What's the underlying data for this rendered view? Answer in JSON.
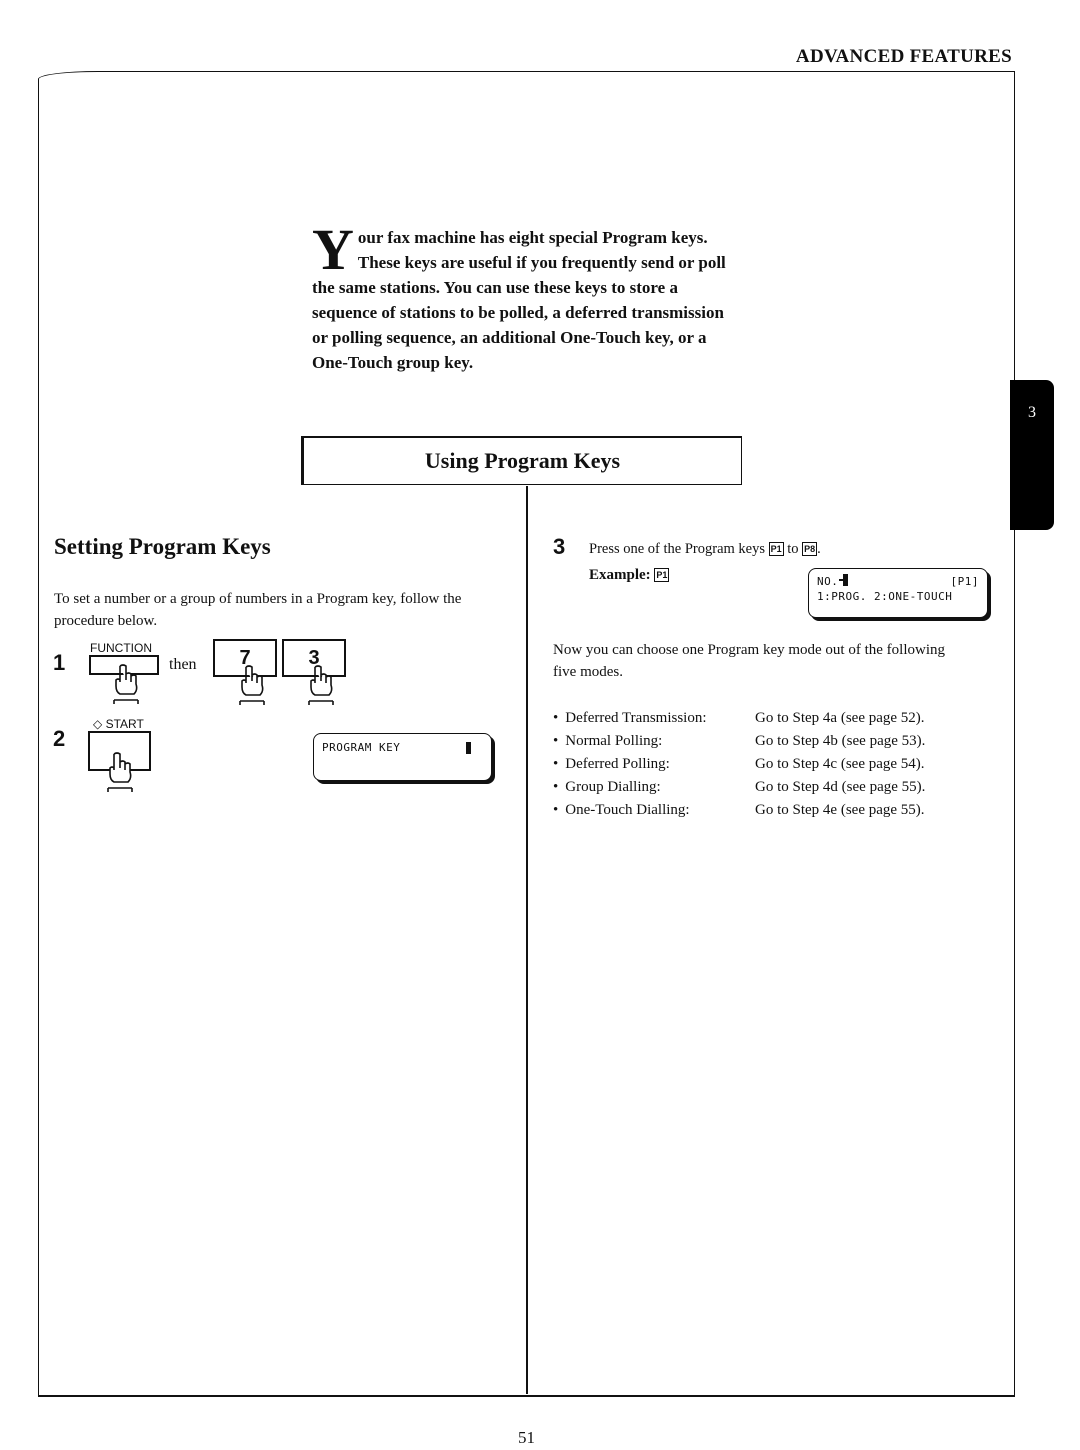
{
  "header": {
    "section_title": "ADVANCED FEATURES"
  },
  "chapter_tab": {
    "number": "3"
  },
  "intro": {
    "drop_cap": "Y",
    "text": "our fax machine has eight special Program keys.  These keys are useful if you frequently send or poll the same stations.  You can use these keys to store a sequence of stations to be polled, a deferred transmission or polling sequence, an additional One-Touch key, or a One-Touch group key."
  },
  "title_box": {
    "title": "Using Program Keys"
  },
  "left": {
    "heading": "Setting Program Keys",
    "lead": "To set a number or a group of numbers in a Program key, follow the procedure below.",
    "step1": {
      "number": "1",
      "function_label": "FUNCTION",
      "then": "then",
      "keys": [
        "7",
        "3"
      ]
    },
    "step2": {
      "number": "2",
      "start_label": "◇ START",
      "display": {
        "line1": "PROGRAM KEY"
      }
    }
  },
  "right": {
    "step3": {
      "number": "3",
      "text_before": "Press one of the Program keys ",
      "key_from": "P1",
      "text_mid": " to ",
      "key_to": "P8",
      "text_after": ".",
      "example_label": "Example: ",
      "example_key": "P1",
      "display": {
        "line1_left": "NO.",
        "line1_right": "[P1]",
        "line2": "1:PROG. 2:ONE-TOUCH"
      }
    },
    "intro_text": "Now you can choose one Program key mode out of the following five modes.",
    "modes": [
      {
        "name": "Deferred Transmission:",
        "action": "Go to Step 4a (see page 52)."
      },
      {
        "name": "Normal Polling:",
        "action": "Go to Step 4b (see page 53)."
      },
      {
        "name": "Deferred Polling:",
        "action": "Go to Step 4c (see page 54)."
      },
      {
        "name": "Group Dialling:",
        "action": "Go to Step 4d (see page 55)."
      },
      {
        "name": "One-Touch Dialling:",
        "action": "Go to Step 4e (see page 55)."
      }
    ]
  },
  "footer": {
    "page_number": "51"
  }
}
